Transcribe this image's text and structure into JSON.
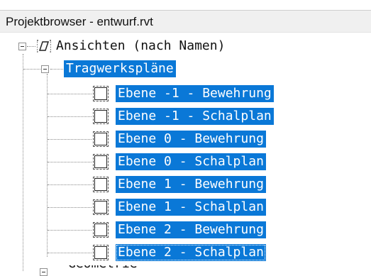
{
  "panel": {
    "title": "Projektbrowser - entwurf.rvt"
  },
  "tree": {
    "root": {
      "label": "Ansichten (nach Namen)",
      "icon": "views-icon",
      "expanded": true
    },
    "group": {
      "label": "Tragwerkspläne",
      "expanded": true,
      "selected": true
    },
    "sheets": [
      {
        "label": "Ebene -1 - Bewehrung",
        "selected": true
      },
      {
        "label": "Ebene -1 - Schalplan",
        "selected": true
      },
      {
        "label": "Ebene 0 - Bewehrung",
        "selected": true
      },
      {
        "label": "Ebene 0 - Schalplan",
        "selected": true
      },
      {
        "label": "Ebene 1 - Bewehrung",
        "selected": true
      },
      {
        "label": "Ebene 1 - Schalplan",
        "selected": true
      },
      {
        "label": "Ebene 2 - Bewehrung",
        "selected": true
      },
      {
        "label": "Ebene 2 - Schalplan",
        "selected": true,
        "focused": true
      }
    ],
    "next_partial": {
      "label": "Geometrie"
    }
  },
  "colors": {
    "selection": "#0a78d7",
    "header_bg": "#f0f0f0"
  }
}
